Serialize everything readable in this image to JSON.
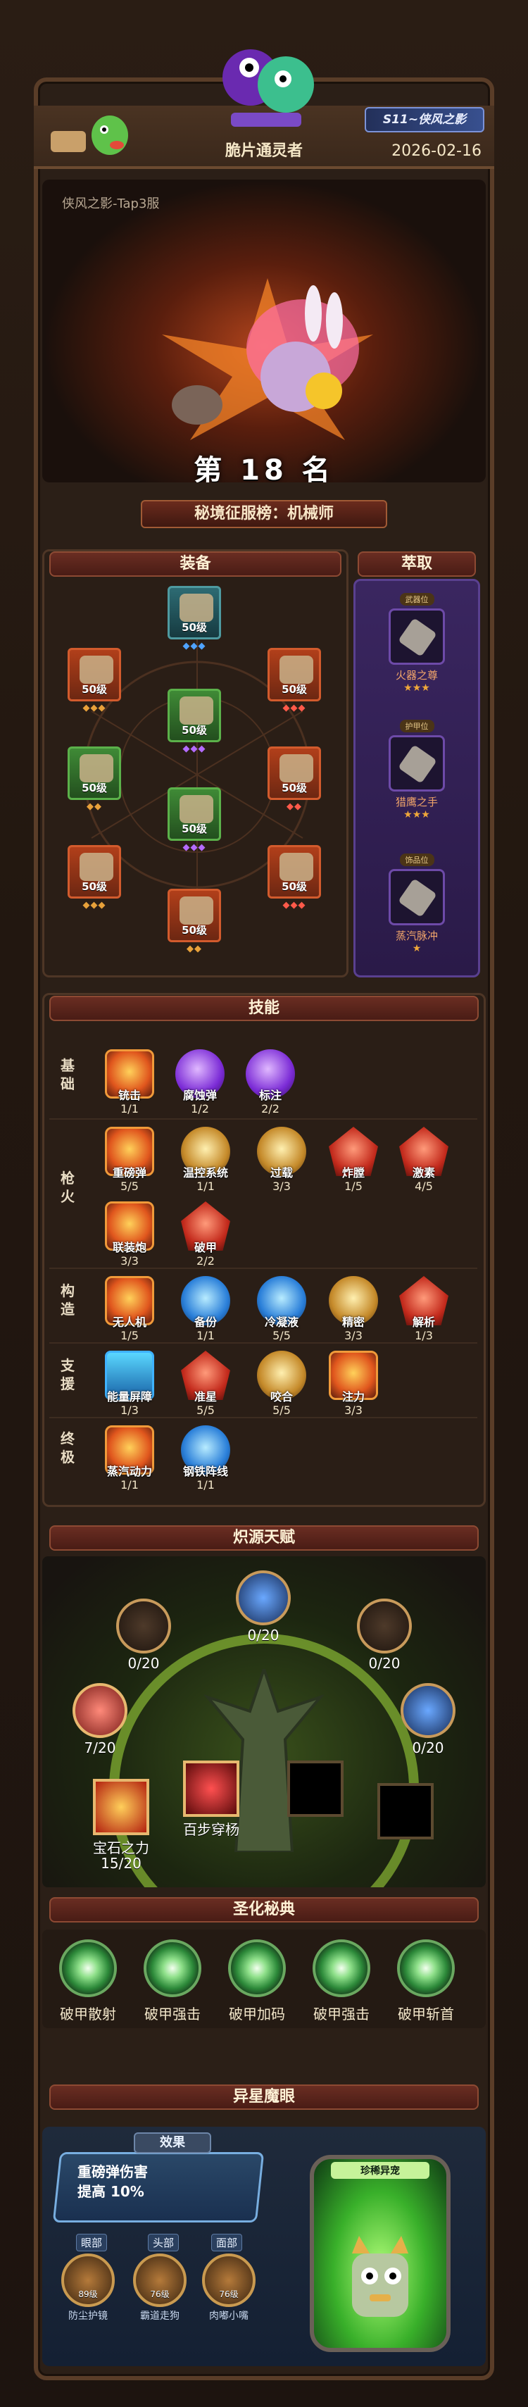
{
  "header": {
    "player_name": "脆片通灵者",
    "date": "2026-02-16",
    "season_badge": "S11~侠风之影"
  },
  "rank": {
    "server": "侠风之影-Tap3服",
    "rank_text": "第 18 名",
    "category": "秘境征服榜：机械师"
  },
  "equipment": {
    "title": "装备",
    "level_text": "50级",
    "slots": [
      {
        "level": "50级",
        "gems": "◆◆◆",
        "gem_color": "blue"
      },
      {
        "level": "50级",
        "gems": "◆◆◆",
        "gem_color": "orange"
      },
      {
        "level": "50级",
        "gems": "◆◆◆",
        "gem_color": "red"
      },
      {
        "level": "50级",
        "gems": "◆◆◆",
        "gem_color": "purple"
      },
      {
        "level": "50级",
        "gems": "◆◆",
        "gem_color": "orange"
      },
      {
        "level": "50级",
        "gems": "◆◆",
        "gem_color": "red"
      },
      {
        "level": "50级",
        "gems": "◆◆◆",
        "gem_color": "purple"
      },
      {
        "level": "50级",
        "gems": "◆◆◆",
        "gem_color": "orange"
      },
      {
        "level": "50级",
        "gems": "◆◆◆",
        "gem_color": "red"
      },
      {
        "level": "50级",
        "gems": "◆◆",
        "gem_color": "orange"
      }
    ]
  },
  "extract": {
    "title": "萃取",
    "items": [
      {
        "tag": "武器位",
        "name": "火器之尊",
        "stars": "★★★"
      },
      {
        "tag": "护甲位",
        "name": "猎鹰之手",
        "stars": "★★★"
      },
      {
        "tag": "饰品位",
        "name": "蒸汽脉冲",
        "stars": "★"
      }
    ]
  },
  "skills": {
    "title": "技能",
    "rows": [
      {
        "label": "基础",
        "items": [
          {
            "name": "铳击",
            "level": "1/1",
            "style": "orange"
          },
          {
            "name": "腐蚀弹",
            "level": "1/2",
            "style": "purple"
          },
          {
            "name": "标注",
            "level": "2/2",
            "style": "purple"
          }
        ]
      },
      {
        "label": "枪火",
        "items": [
          {
            "name": "重磅弹",
            "level": "5/5",
            "style": "orange"
          },
          {
            "name": "温控系统",
            "level": "1/1",
            "style": "gold"
          },
          {
            "name": "过载",
            "level": "3/3",
            "style": "gold"
          },
          {
            "name": "炸膛",
            "level": "1/5",
            "style": "red"
          },
          {
            "name": "激素",
            "level": "4/5",
            "style": "red"
          },
          {
            "name": "联装炮",
            "level": "3/3",
            "style": "orange"
          },
          {
            "name": "破甲",
            "level": "2/2",
            "style": "red"
          }
        ]
      },
      {
        "label": "构造",
        "items": [
          {
            "name": "无人机",
            "level": "1/5",
            "style": "orange"
          },
          {
            "name": "备份",
            "level": "1/1",
            "style": "blue"
          },
          {
            "name": "冷凝液",
            "level": "5/5",
            "style": "blue"
          },
          {
            "name": "精密",
            "level": "3/3",
            "style": "gold"
          },
          {
            "name": "解析",
            "level": "1/3",
            "style": "red"
          }
        ]
      },
      {
        "label": "支援",
        "items": [
          {
            "name": "能量屏障",
            "level": "1/3",
            "style": "cyan"
          },
          {
            "name": "准星",
            "level": "5/5",
            "style": "red"
          },
          {
            "name": "咬合",
            "level": "5/5",
            "style": "gold"
          },
          {
            "name": "注力",
            "level": "3/3",
            "style": "orange"
          }
        ]
      },
      {
        "label": "终极",
        "items": [
          {
            "name": "蒸汽动力",
            "level": "1/1",
            "style": "orange"
          },
          {
            "name": "钢铁阵线",
            "level": "1/1",
            "style": "blue"
          }
        ]
      }
    ]
  },
  "talent": {
    "title": "炽源天赋",
    "nodes": [
      {
        "value": "0/20"
      },
      {
        "value": "0/20"
      },
      {
        "value": "0/20"
      },
      {
        "value": "7/20"
      },
      {
        "value": "0/20"
      }
    ],
    "hundred_steps": "百步穿杨",
    "gem_power": "宝石之力",
    "gem_power_value": "15/20"
  },
  "codex": {
    "title": "圣化秘典",
    "items": [
      "破甲散射",
      "破甲强击",
      "破甲加码",
      "破甲强击",
      "破甲斩首"
    ]
  },
  "alien_eye": {
    "title": "异星魔眼",
    "effect_tag": "效果",
    "effect_line1": "重磅弹伤害",
    "effect_line2": "提高 10%",
    "tabs": [
      "眼部",
      "头部",
      "面部"
    ],
    "slots": [
      {
        "level": "89级",
        "name": "防尘护镜"
      },
      {
        "level": "76级",
        "name": "霸道走狗"
      },
      {
        "level": "76级",
        "name": "肉嘟小嘴"
      }
    ],
    "tube_label": "珍稀异宠"
  }
}
